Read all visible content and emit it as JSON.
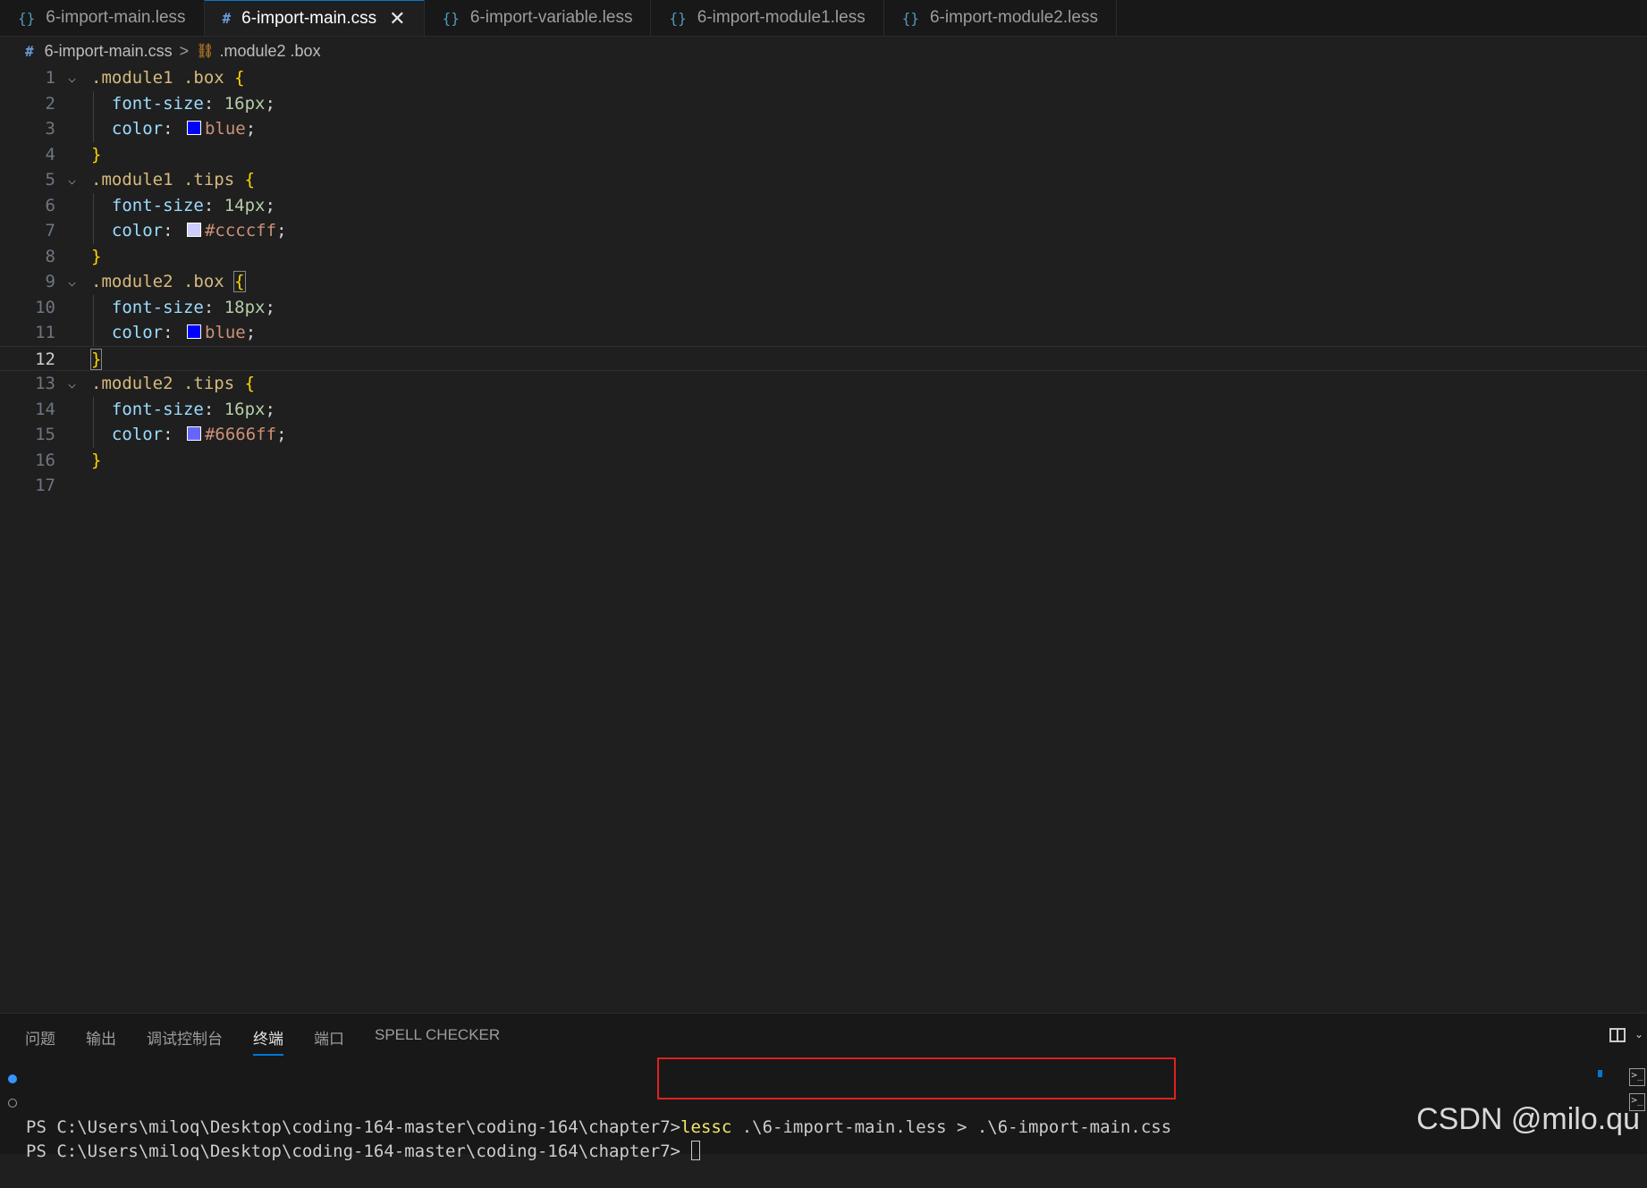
{
  "tabs": [
    {
      "icon": "{}",
      "label": "6-import-main.less",
      "active": false
    },
    {
      "icon": "#",
      "label": "6-import-main.css",
      "active": true,
      "close": "✕"
    },
    {
      "icon": "{}",
      "label": "6-import-variable.less",
      "active": false
    },
    {
      "icon": "{}",
      "label": "6-import-module1.less",
      "active": false
    },
    {
      "icon": "{}",
      "label": "6-import-module2.less",
      "active": false
    }
  ],
  "breadcrumb": {
    "file_icon": "#",
    "file": "6-import-main.css",
    "separator": ">",
    "symbol": ".module2 .box"
  },
  "editor": {
    "current_line": 12,
    "lines": [
      {
        "n": "1",
        "sel": ".module1 .box",
        "brace": "{"
      },
      {
        "n": "2",
        "prop": "font-size",
        "value": "16px"
      },
      {
        "n": "3",
        "prop": "color",
        "value": "blue",
        "swatch": "#0000ff"
      },
      {
        "n": "4",
        "brace": "}"
      },
      {
        "n": "5",
        "sel": ".module1 .tips",
        "brace": "{"
      },
      {
        "n": "6",
        "prop": "font-size",
        "value": "14px"
      },
      {
        "n": "7",
        "prop": "color",
        "value": "#ccccff",
        "swatch": "#ccccff"
      },
      {
        "n": "8",
        "brace": "}"
      },
      {
        "n": "9",
        "sel": ".module2 .box",
        "brace": "{"
      },
      {
        "n": "10",
        "prop": "font-size",
        "value": "18px"
      },
      {
        "n": "11",
        "prop": "color",
        "value": "blue",
        "swatch": "#0000ff"
      },
      {
        "n": "12",
        "brace": "}"
      },
      {
        "n": "13",
        "sel": ".module2 .tips",
        "brace": "{"
      },
      {
        "n": "14",
        "prop": "font-size",
        "value": "16px"
      },
      {
        "n": "15",
        "prop": "color",
        "value": "#6666ff",
        "swatch": "#6666ff"
      },
      {
        "n": "16",
        "brace": "}"
      },
      {
        "n": "17"
      }
    ]
  },
  "panel": {
    "tabs": [
      "问题",
      "输出",
      "调试控制台",
      "终端",
      "端口",
      "SPELL CHECKER"
    ],
    "active_tab": "终端"
  },
  "terminal": {
    "prompt": "PS C:\\Users\\miloq\\Desktop\\coding-164-master\\coding-164\\chapter7>",
    "command_keyword": "lessc",
    "command_args": " .\\6-import-main.less > .\\6-import-main.css"
  },
  "watermark": "CSDN @milo.qu",
  "colors": {
    "accent": "#0078d4",
    "highlight_box": "#e02020",
    "selector": "#d7ba7d",
    "property": "#9cdcfe",
    "number": "#b5cea8",
    "value": "#ce9178",
    "brace": "#ffd700"
  }
}
